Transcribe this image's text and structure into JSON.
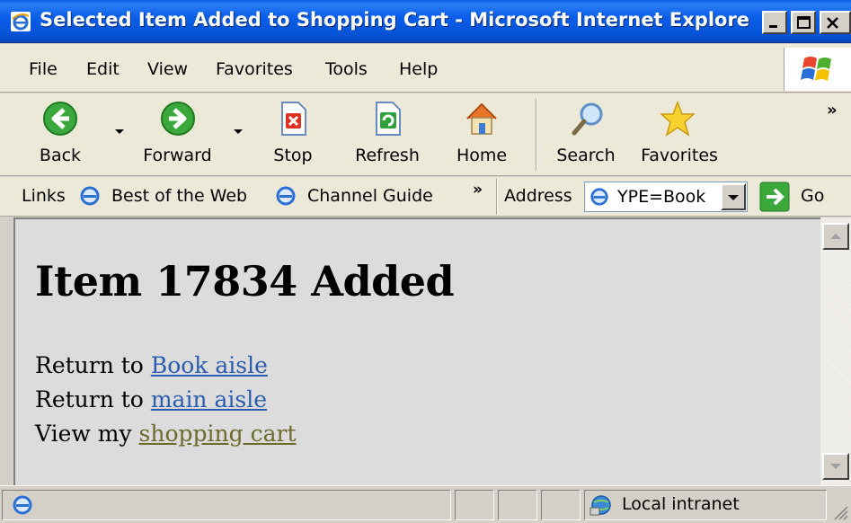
{
  "window": {
    "title": "Selected Item Added to Shopping Cart - Microsoft Internet Explorer ...",
    "minimize": "minimize",
    "maximize": "maximize",
    "close": "close"
  },
  "menu": {
    "items": [
      "File",
      "Edit",
      "View",
      "Favorites",
      "Tools",
      "Help"
    ]
  },
  "toolbar": {
    "back": "Back",
    "forward": "Forward",
    "stop": "Stop",
    "refresh": "Refresh",
    "home": "Home",
    "search": "Search",
    "favorites": "Favorites",
    "more": "»"
  },
  "links_bar": {
    "label": "Links",
    "items": [
      "Best of the Web",
      "Channel Guide"
    ],
    "more": "»"
  },
  "address_bar": {
    "label": "Address",
    "value": "YPE=Book",
    "go": "Go"
  },
  "page": {
    "heading": "Item 17834 Added",
    "lines": [
      {
        "prefix": "Return to",
        "link": "Book aisle"
      },
      {
        "prefix": "Return to",
        "link": "main aisle"
      },
      {
        "prefix": "View my",
        "link": "shopping cart"
      }
    ]
  },
  "status": {
    "zone": "Local intranet"
  },
  "colors": {
    "titlebar": "#0a5ee8",
    "link": "#2a5db0",
    "visited_link": "#6b6b2c",
    "content_bg": "#dcdcdc"
  }
}
